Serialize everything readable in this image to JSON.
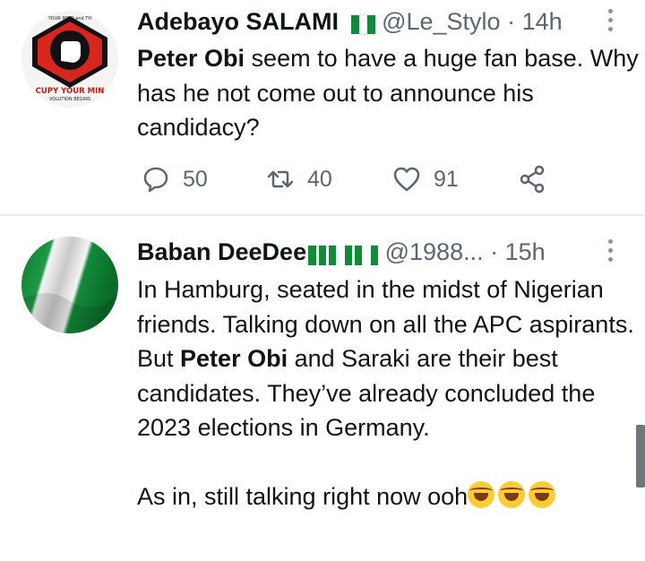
{
  "tweets": [
    {
      "display_name": "Adebayo SALAMI",
      "handle": "@Le_Stylo",
      "separator": "·",
      "time": "14h",
      "avatar_text_top": "YOUR MIND and TH",
      "avatar_text_main": "CUPY YOUR MIN",
      "avatar_text_sub": "VOLUTION BEGINS",
      "text_bold": "Peter Obi",
      "text_rest": " seem to have a huge fan base. Why has he not come out to announce his candidacy?",
      "replies": "50",
      "retweets": "40",
      "likes": "91"
    },
    {
      "display_name": "Baban DeeDee",
      "handle": "@1988...",
      "separator": "·",
      "time": "15h",
      "text_p1_a": "In Hamburg, seated in the midst of Nigerian friends. Talking down on all the APC aspirants. But ",
      "text_p1_bold": "Peter Obi",
      "text_p1_b": " and Saraki are their best candidates. They’ve already concluded the 2023 elections in Germany.",
      "text_p2": "As in, still talking right now ooh"
    }
  ],
  "icons": {
    "reply": "speech-bubble-icon",
    "retweet": "retweet-arrows-icon",
    "like": "heart-icon",
    "share": "share-icon",
    "more": "vertical-dots-icon",
    "emoji": "tears-of-joy-emoji"
  },
  "colors": {
    "nigeria_green": "#118a3a",
    "muted": "#5b6670",
    "divider": "#e8ebee"
  }
}
